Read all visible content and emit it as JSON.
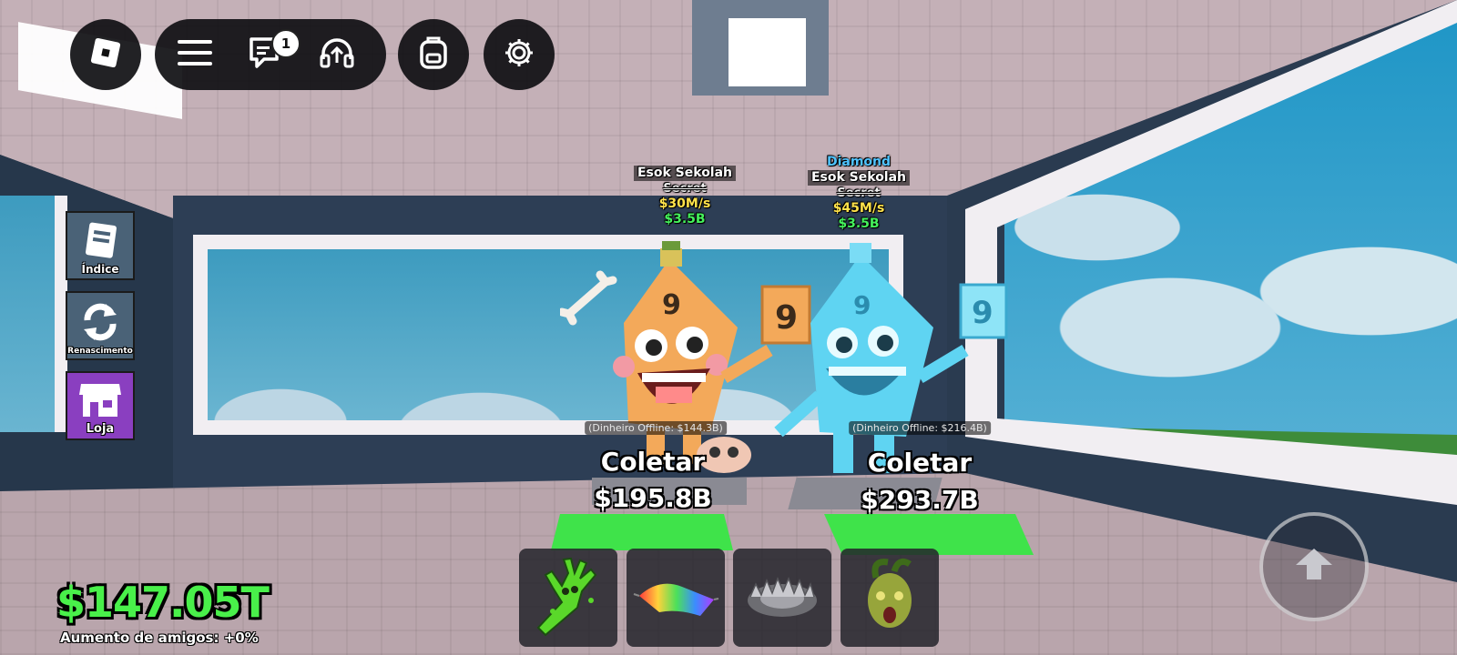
{
  "topbar": {
    "roblox_icon": "roblox-logo-icon",
    "menu_icon": "hamburger-menu-icon",
    "chat_icon": "chat-icon",
    "chat_badge": "1",
    "voice_icon": "headphones-icon",
    "backpack_icon": "backpack-icon",
    "settings_icon": "gear-icon"
  },
  "side_menu": {
    "items": [
      {
        "label": "Índice",
        "icon": "book-icon",
        "color": "#4a6277"
      },
      {
        "label": "Renascimento",
        "icon": "refresh-icon",
        "color": "#4a6277"
      },
      {
        "label": "Loja",
        "icon": "shop-icon",
        "color": "#8a3fc0"
      }
    ]
  },
  "brainrots": [
    {
      "mutation": "",
      "name": "Esok Sekolah",
      "rarity": "Secret",
      "rate": "$30M/s",
      "price": "$3.5B",
      "offline": "(Dinheiro Offline: $144.3B)",
      "collect_label": "Coletar",
      "collect_amount": "$195.8B",
      "sign_number": "9"
    },
    {
      "mutation": "Diamond",
      "name": "Esok Sekolah",
      "rarity": "Secret",
      "rate": "$45M/s",
      "price": "$3.5B",
      "offline": "(Dinheiro Offline: $216.4B)",
      "collect_label": "Coletar",
      "collect_amount": "$293.7B",
      "sign_number": "9"
    }
  ],
  "player": {
    "money": "$147.05T",
    "friend_boost": "Aumento de amigos: +0%"
  },
  "hotbar": {
    "items": [
      {
        "icon": "slime-glove-icon"
      },
      {
        "icon": "rainbow-carpet-icon"
      },
      {
        "icon": "bear-trap-icon"
      },
      {
        "icon": "medusa-head-icon"
      }
    ]
  },
  "controls": {
    "jump_icon": "jump-arrow-icon"
  },
  "colors": {
    "money_green": "#49f04a",
    "rate_yellow": "#ffe24a",
    "price_green": "#45f25c",
    "diamond_blue": "#4fc3ff",
    "pad_green": "#3fe34a"
  }
}
